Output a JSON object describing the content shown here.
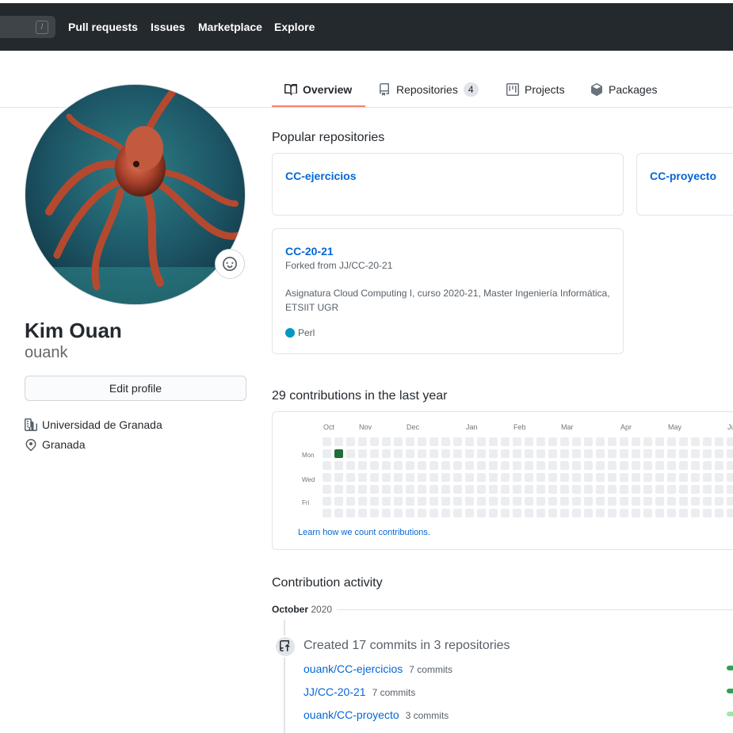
{
  "nav": {
    "search_hint": "/",
    "links": [
      "Pull requests",
      "Issues",
      "Marketplace",
      "Explore"
    ]
  },
  "tabs": [
    {
      "label": "Overview",
      "icon": "book-icon"
    },
    {
      "label": "Repositories",
      "icon": "repo-icon",
      "count": "4"
    },
    {
      "label": "Projects",
      "icon": "project-icon"
    },
    {
      "label": "Packages",
      "icon": "package-icon"
    }
  ],
  "profile": {
    "name": "Kim Ouan",
    "username": "ouank",
    "edit_label": "Edit profile",
    "organization": "Universidad de Granada",
    "location": "Granada"
  },
  "popular": {
    "title": "Popular repositories",
    "repos": [
      {
        "name": "CC-ejercicios"
      },
      {
        "name": "CC-proyecto"
      },
      {
        "name": "CC-20-21",
        "forked": "Forked from JJ/CC-20-21",
        "description": "Asignatura Cloud Computing I, curso 2020-21, Master Ingeniería Informática, ETSIIT UGR",
        "language": "Perl",
        "language_color": "#0298c3"
      }
    ]
  },
  "contributions": {
    "title": "29 contributions in the last year",
    "months": [
      "Oct",
      "Nov",
      "Dec",
      "Jan",
      "Feb",
      "Mar",
      "Apr",
      "May",
      "Ju"
    ],
    "days": [
      "Mon",
      "Wed",
      "Fri"
    ],
    "learn_link": "Learn how we count contributions.",
    "empty_color": "#ebedf0",
    "active_color": "#216e39"
  },
  "activity": {
    "title": "Contribution activity",
    "period_month": "October",
    "period_year": "2020",
    "summary": "Created 17 commits in 3 repositories",
    "rows": [
      {
        "repo": "ouank/CC-ejercicios",
        "commits": "7 commits",
        "bar_color": "#30a14e"
      },
      {
        "repo": "JJ/CC-20-21",
        "commits": "7 commits",
        "bar_color": "#30a14e"
      },
      {
        "repo": "ouank/CC-proyecto",
        "commits": "3 commits",
        "bar_color": "#9be9a8"
      }
    ]
  }
}
